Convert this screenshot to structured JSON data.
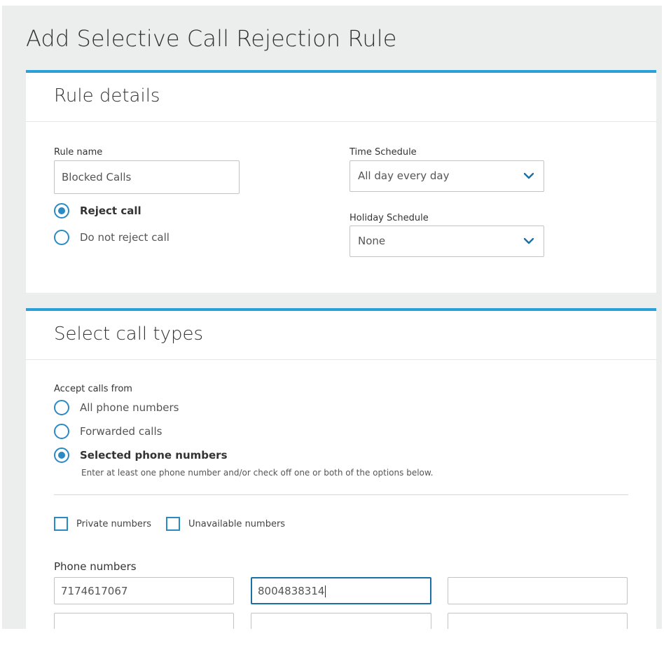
{
  "page": {
    "title": "Add Selective Call Rejection Rule"
  },
  "rule_details": {
    "title": "Rule details",
    "rule_name_label": "Rule name",
    "rule_name_value": "Blocked Calls",
    "reject_options": [
      {
        "label": "Reject call",
        "selected": true
      },
      {
        "label": "Do not reject call",
        "selected": false
      }
    ],
    "time_schedule_label": "Time Schedule",
    "time_schedule_value": "All day every day",
    "holiday_schedule_label": "Holiday Schedule",
    "holiday_schedule_value": "None"
  },
  "call_types": {
    "title": "Select call types",
    "accept_label": "Accept calls from",
    "options": [
      {
        "label": "All phone numbers",
        "selected": false
      },
      {
        "label": "Forwarded calls",
        "selected": false
      },
      {
        "label": "Selected phone numbers",
        "selected": true
      }
    ],
    "hint": "Enter at least one phone number and/or check off one or both of the options below.",
    "checkboxes": [
      {
        "label": "Private numbers",
        "checked": false
      },
      {
        "label": "Unavailable numbers",
        "checked": false
      }
    ],
    "phone_numbers_label": "Phone numbers",
    "phone_numbers": [
      "7174617067",
      "8004838314",
      "",
      "",
      "",
      ""
    ]
  },
  "colors": {
    "accent": "#2a9fd8",
    "radio": "#2a8ac4",
    "focus": "#1b6fa2",
    "page_bg": "#eceeee"
  },
  "icons": {
    "dropdown": "chevron-down-icon"
  }
}
